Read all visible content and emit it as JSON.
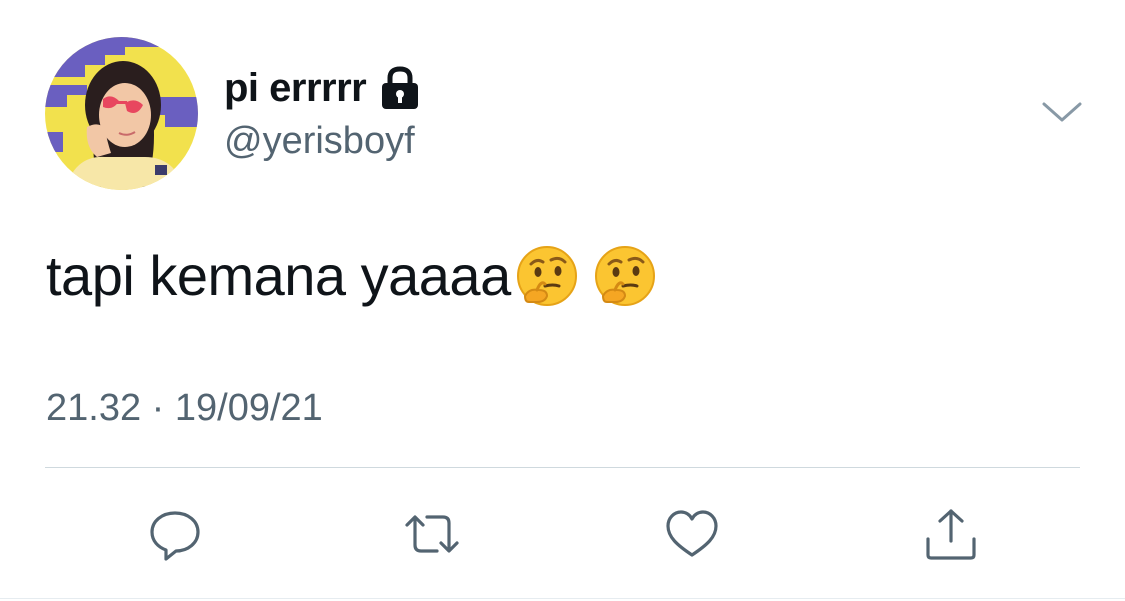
{
  "user": {
    "display_name": "pi errrrr",
    "handle": "@yerisboyf",
    "protected_icon": "lock-icon",
    "avatar_icon": "avatar-photo"
  },
  "tweet": {
    "text": "tapi kemana yaaaa",
    "emojis": [
      "thinking-face-emoji",
      "thinking-face-emoji"
    ],
    "timestamp": "21.32 · 19/09/21"
  },
  "actions": [
    {
      "name": "reply",
      "icon": "speech-bubble-icon"
    },
    {
      "name": "retweet",
      "icon": "retweet-icon"
    },
    {
      "name": "like",
      "icon": "heart-icon"
    },
    {
      "name": "share",
      "icon": "share-icon"
    }
  ],
  "colors": {
    "text": "#0f1419",
    "secondary": "#536471",
    "icon": "#536471",
    "divider": "#cfd9de",
    "avatar_bg_yellow": "#f4e34a",
    "avatar_stripe_purple": "#6a5fc0"
  }
}
